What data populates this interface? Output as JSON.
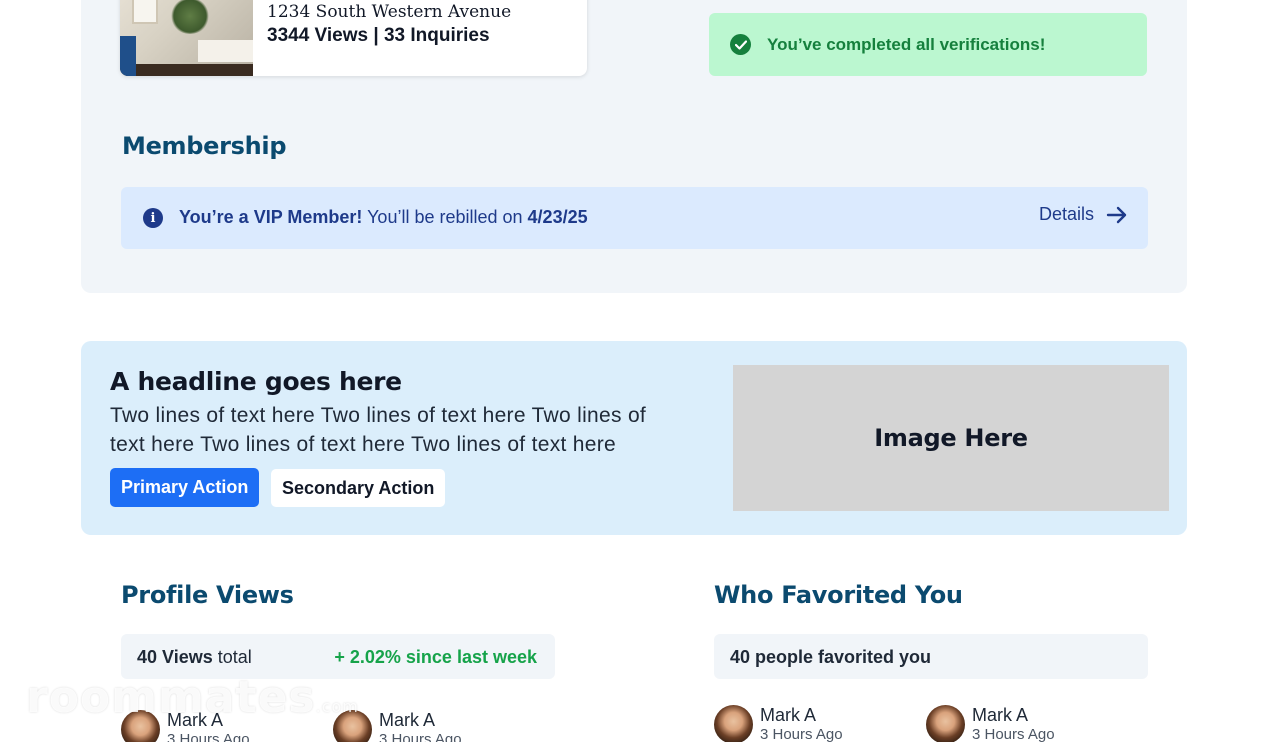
{
  "listing": {
    "address": "1234 South Western Avenue",
    "stats": "3344 Views | 33 Inquiries"
  },
  "verification": {
    "message": "You’ve completed all verifications!"
  },
  "membership": {
    "title": "Membership",
    "vip_bold": "You’re a VIP Member!",
    "vip_text": " You’ll be rebilled on ",
    "rebill_date": "4/23/25",
    "details_label": "Details"
  },
  "promo": {
    "headline": "A headline goes here",
    "body": "Two lines of text here Two lines of text here Two lines of text here Two lines of text here Two lines of text here",
    "primary_label": "Primary Action",
    "secondary_label": "Secondary Action",
    "image_label": "Image Here"
  },
  "profile_views": {
    "title": "Profile Views",
    "count_bold": "40 Views",
    "count_suffix": " total",
    "change": "+ 2.02% since last week",
    "people": [
      {
        "name": "Mark A",
        "time": "3 Hours Ago"
      },
      {
        "name": "Mark A",
        "time": "3 Hours Ago"
      }
    ]
  },
  "favorites": {
    "title": "Who Favorited You",
    "summary": "40 people favorited you",
    "people": [
      {
        "name": "Mark A",
        "time": "3 Hours Ago"
      },
      {
        "name": "Mark A",
        "time": "3 Hours Ago"
      }
    ]
  },
  "watermark": {
    "text": "roommates",
    "suffix": ".com"
  },
  "colors": {
    "accent": "#1d6ef5",
    "heading": "#0b4a6f",
    "success": "#15803d",
    "info": "#1e3a8a"
  }
}
